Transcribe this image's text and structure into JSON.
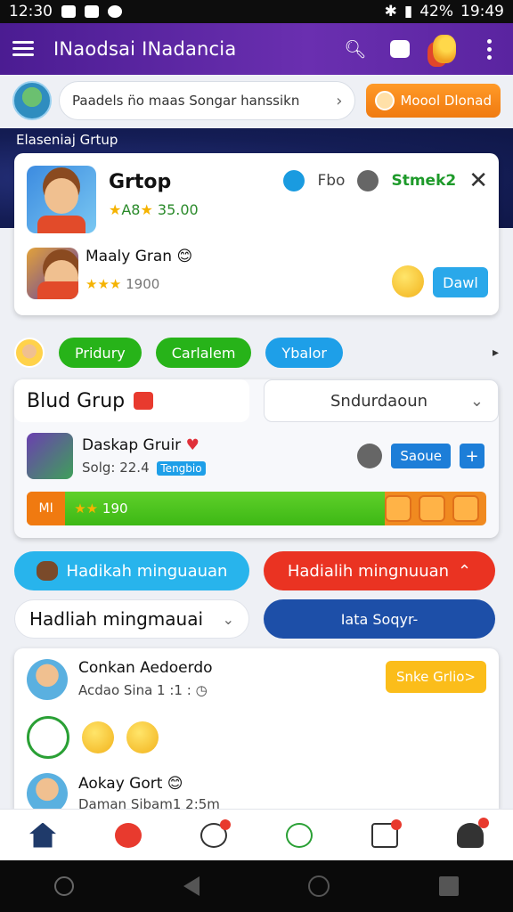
{
  "status_bar": {
    "time": "12:30",
    "battery": "42%",
    "clock": "19:49"
  },
  "app_bar": {
    "title": "INaodsai INadancia"
  },
  "search": {
    "text": "Paadels n̈o maas Songar hanssikn",
    "button": "Moool Dlonad"
  },
  "banner": {
    "label": "Elaseniaj Grtup"
  },
  "card_top": {
    "title": "Grtop",
    "rating_text": "A8",
    "price": "35.00",
    "meta_text": "Fbo",
    "status": "Stmek2",
    "sub_name": "Maaly Gran",
    "sub_stars": "1900",
    "action": "Dawl"
  },
  "chips": [
    "Pridury",
    "Carlalem",
    "Ybalor"
  ],
  "group": {
    "title": "Blud Grup",
    "select": "Sndurdaoun",
    "member_name": "Daskap Gruir",
    "member_sub": "Solg: 22.4",
    "member_tag": "Tengbio",
    "save_label": "Saoue",
    "progress_lead": "MI",
    "progress_text": "190",
    "progress_fraction": 0.77
  },
  "rewards": {
    "blue": "Hadikah minguauan",
    "red": "Hadialih mingnuuan",
    "white": "Hadliah mingmauai",
    "navy": "Iata Soqyr-"
  },
  "list": {
    "item1_name": "Conkan Aedoerdo",
    "item1_sub": "Acdao Sina 1 :1 :",
    "item1_button": "Snke Grlio>",
    "item2_name": "Aokay Gort",
    "item2_sub": "Daman Sibam1 2:5m"
  },
  "colors": {
    "appbar": "#5a24a0",
    "accent_green": "#27b319",
    "accent_blue": "#1e9fe8",
    "accent_red": "#ea3322"
  }
}
